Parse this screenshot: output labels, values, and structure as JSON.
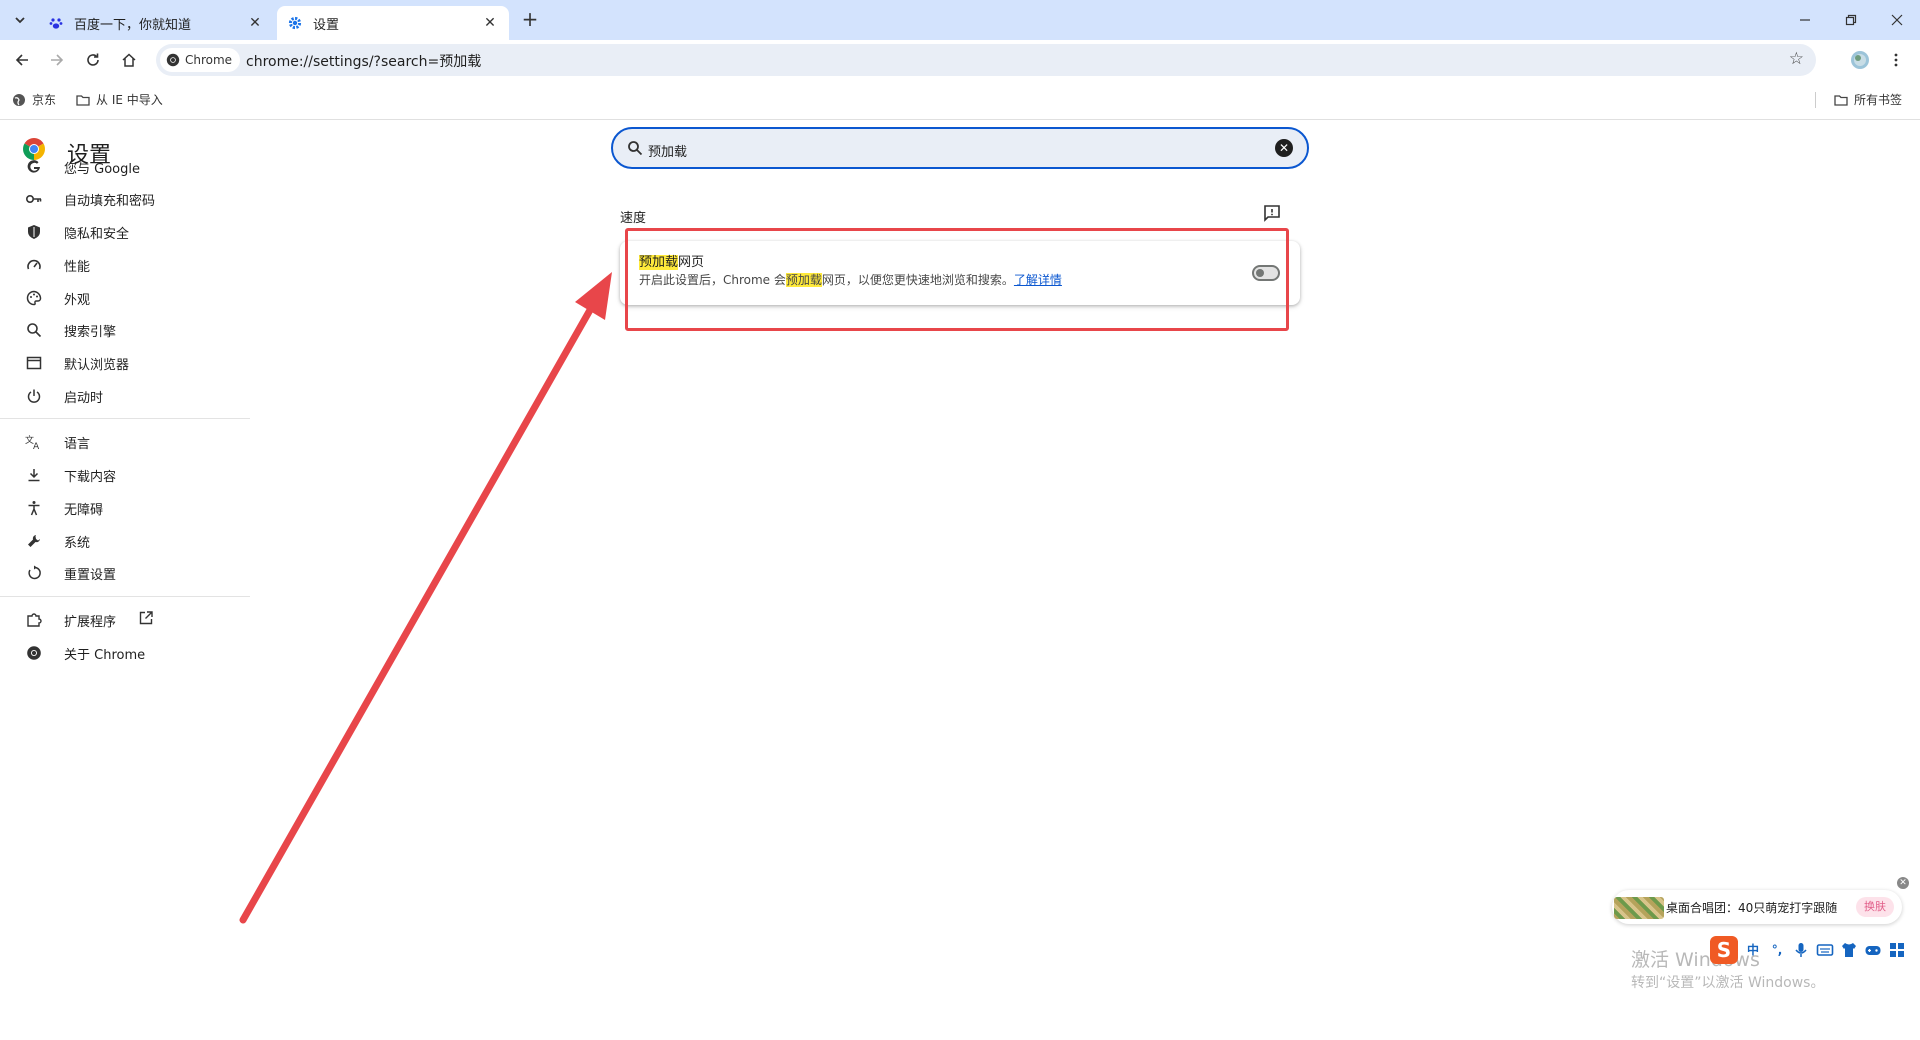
{
  "browser": {
    "tabs": [
      {
        "title": "百度一下，你就知道",
        "icon": "baidu-paw-icon",
        "active": false
      },
      {
        "title": "设置",
        "icon": "gear-icon",
        "active": true
      }
    ],
    "new_tab_label": "+",
    "address": {
      "chip_label": "Chrome",
      "url": "chrome://settings/?search=预加载"
    },
    "bookmarks": [
      {
        "label": "京东",
        "icon": "globe-icon"
      },
      {
        "label": "从 IE 中导入",
        "icon": "folder-icon"
      }
    ],
    "all_bookmarks_label": "所有书签"
  },
  "settings": {
    "title": "设置",
    "nav_groups": [
      [
        {
          "label": "您与 Google",
          "icon": "google-g-icon"
        },
        {
          "label": "自动填充和密码",
          "icon": "key-icon"
        },
        {
          "label": "隐私和安全",
          "icon": "shield-icon"
        },
        {
          "label": "性能",
          "icon": "speedometer-icon"
        },
        {
          "label": "外观",
          "icon": "palette-icon"
        },
        {
          "label": "搜索引擎",
          "icon": "search-icon"
        },
        {
          "label": "默认浏览器",
          "icon": "browser-window-icon"
        },
        {
          "label": "启动时",
          "icon": "power-icon"
        }
      ],
      [
        {
          "label": "语言",
          "icon": "translate-icon"
        },
        {
          "label": "下载内容",
          "icon": "download-icon"
        },
        {
          "label": "无障碍",
          "icon": "accessibility-icon"
        },
        {
          "label": "系统",
          "icon": "wrench-icon"
        },
        {
          "label": "重置设置",
          "icon": "reset-icon"
        }
      ],
      [
        {
          "label": "扩展程序",
          "icon": "puzzle-icon",
          "external": true
        },
        {
          "label": "关于 Chrome",
          "icon": "chrome-logo-icon"
        }
      ]
    ],
    "search_value": "预加载",
    "section_title": "速度",
    "setting": {
      "title_highlight": "预加载",
      "title_rest": "网页",
      "desc_before": "开启此设置后，Chrome 会",
      "desc_highlight": "预加载",
      "desc_after": "网页，以便您更快速地浏览和搜索。",
      "learn_more": "了解详情",
      "enabled": false
    }
  },
  "ime": {
    "banner_text": "桌面合唱团：40只萌宠打字跟随",
    "skin_button": "换肤",
    "toolbar_items": [
      "中",
      "°,",
      "mic",
      "keyboard",
      "shirt",
      "game",
      "grid"
    ],
    "logo_letter": "S"
  },
  "watermark": {
    "line1": "激活 Windows",
    "line2": "转到“设置”以激活 Windows。"
  },
  "colors": {
    "tabstrip": "#d3e3fd",
    "accent": "#0b57d0",
    "highlight": "#ffea3b",
    "annotation_red": "#e8464a"
  }
}
